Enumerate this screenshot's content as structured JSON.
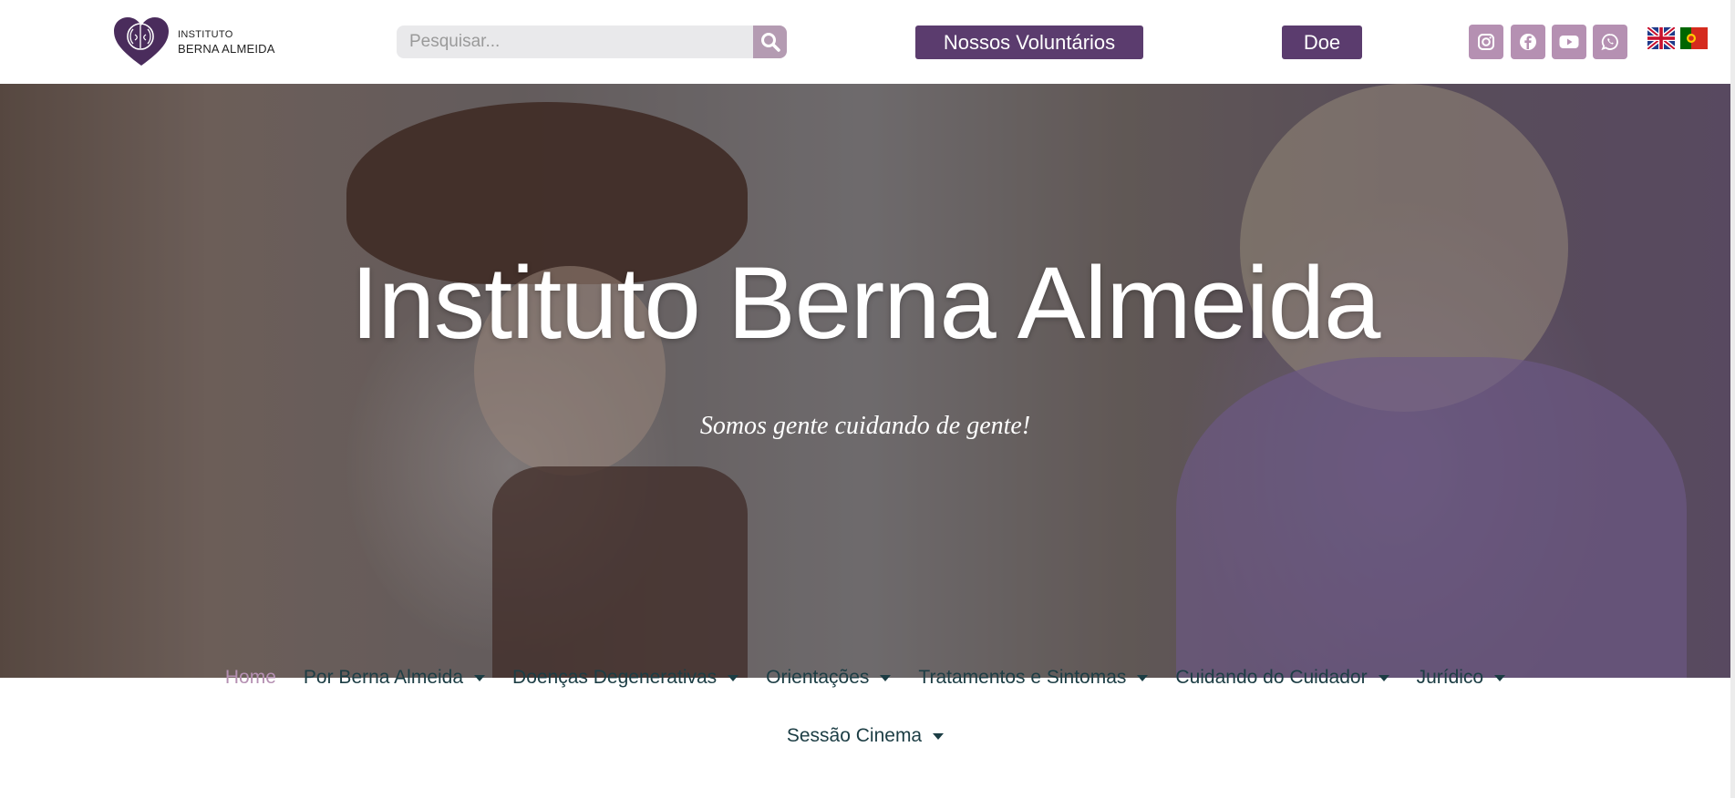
{
  "header": {
    "logo": {
      "line1": "INSTITUTO",
      "line2": "BERNA ALMEIDA"
    },
    "search": {
      "placeholder": "Pesquisar...",
      "value": ""
    },
    "volunteers_label": "Nossos Voluntários",
    "donate_label": "Doe",
    "social": [
      {
        "icon": "instagram-icon"
      },
      {
        "icon": "facebook-icon"
      },
      {
        "icon": "youtube-icon"
      },
      {
        "icon": "whatsapp-icon"
      }
    ],
    "languages": [
      {
        "icon": "uk-flag-icon"
      },
      {
        "icon": "portugal-flag-icon"
      }
    ]
  },
  "hero": {
    "title": "Instituto Berna Almeida",
    "subtitle": "Somos gente cuidando de gente!"
  },
  "nav": {
    "items": [
      {
        "label": "Home"
      },
      {
        "label": "Por Berna Almeida"
      },
      {
        "label": "Doenças Degenerativas"
      },
      {
        "label": "Orientações"
      },
      {
        "label": "Tratamentos e Sintomas"
      },
      {
        "label": "Cuidando do Cuidador"
      },
      {
        "label": "Jurídico"
      },
      {
        "label": "Sessão Cinema"
      }
    ]
  },
  "colors": {
    "brand_purple": "#5b3c6e",
    "accent_pink": "#b590b2",
    "nav_text": "#1c3d44"
  }
}
